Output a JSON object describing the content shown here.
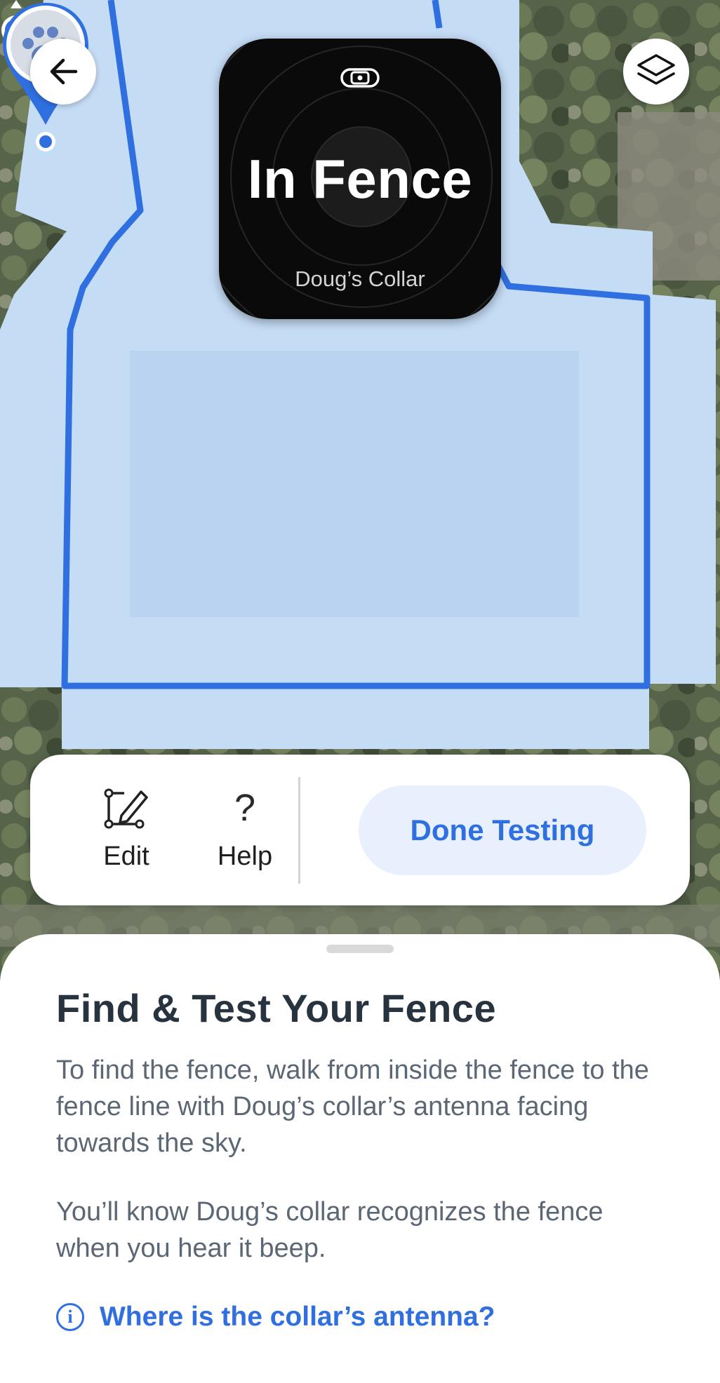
{
  "status": {
    "title": "In Fence",
    "subtitle": "Doug’s Collar"
  },
  "map": {
    "fence_color": "#2f6fe0",
    "zone_color": "#c5dcf5",
    "icons": [
      "back-arrow-icon",
      "layers-icon",
      "paw-icon",
      "user-location-icon"
    ]
  },
  "actions": {
    "edit_label": "Edit",
    "help_label": "Help",
    "help_glyph": "?",
    "done_label": "Done Testing"
  },
  "sheet": {
    "title": "Find & Test Your Fence",
    "paragraph_1": "To find the fence, walk from inside the fence to the fence line with Doug’s collar’s antenna facing towards the sky.",
    "paragraph_2": "You’ll know Doug’s collar recognizes the fence when you hear it beep.",
    "info_glyph": "i",
    "antenna_link": "Where is the collar’s antenna?"
  },
  "colors": {
    "accent": "#2f6fe0",
    "button_bg": "#e8f0fd",
    "card_bg": "#0a0a0a",
    "heading": "#27333f",
    "body_text": "#5b6774"
  }
}
